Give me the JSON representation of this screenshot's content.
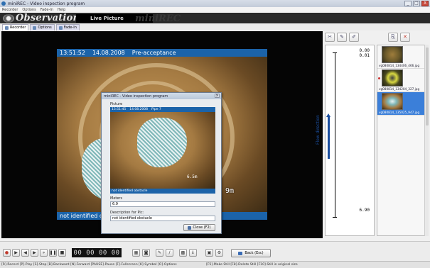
{
  "window": {
    "title": "miniREC - Video inspection program",
    "controls": [
      "_",
      "□",
      "X"
    ]
  },
  "menu": [
    "Recorder",
    "Options",
    "Fade-In",
    "Help"
  ],
  "banner": {
    "brand": "Observation",
    "live_label": "Live Picture",
    "watermark": "miniREC"
  },
  "tabs": [
    {
      "label": "Recorder",
      "active": true
    },
    {
      "label": "Options",
      "active": false
    },
    {
      "label": "Fade-In",
      "active": false
    }
  ],
  "video": {
    "time": "13:51:52",
    "date": "14.08.2008",
    "status": "Pre-acceptance",
    "distance": "9m",
    "caption": "not identified obstacle"
  },
  "dialog": {
    "title": "miniREC - Video inspection program",
    "picture_label": "Picture",
    "pic_header": {
      "time": "13:51:45",
      "date": "14.08.2008",
      "pipe": "Pipe 7"
    },
    "pic_distance": "6.5m",
    "pic_caption": "not identified obstacle",
    "meters_label": "Meters",
    "meters_value": "6.9",
    "description_label": "Description for Pic:",
    "description_value": "not identified obstacle",
    "close_label": "Close (F2)"
  },
  "right_tools": [
    "cut-icon",
    "pen-icon",
    "pen-alt-icon",
    "copy-icon",
    "delete-icon"
  ],
  "flow_panel": {
    "top_values": [
      "0.00",
      "0.01"
    ],
    "bottom_value": "6.90",
    "direction_label": "Flow direction"
  },
  "thumbnails": [
    {
      "name": "vg080814_134406_466.jpg",
      "selected": false,
      "style": "brown"
    },
    {
      "name": "vg080814_134204_327.jpg",
      "selected": false,
      "style": "yellow"
    },
    {
      "name": "vg080814_135025_947.jpg",
      "selected": true,
      "style": "cloth"
    }
  ],
  "timecode": "00 00 00 00",
  "back_button": "Back (Esc)",
  "status_bar": {
    "left": "[R]-Record [P]-Play [S]-Stop [B]-Backward [N]-Forward [PAUSE]-Pause [F]-Fullscreen [K]-Symbol [O]-Options",
    "right": "[F5]-Make Still  [F8]-Delete Still  [F10]-Still in original size"
  }
}
